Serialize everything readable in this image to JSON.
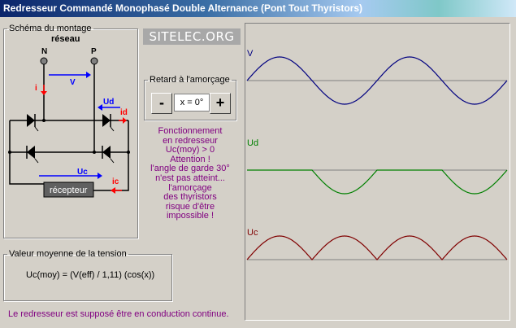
{
  "window": {
    "title": "Redresseur Commandé Monophasé Double Alternance (Pont Tout Thyristors)"
  },
  "schema": {
    "legend": "Schéma du montage",
    "network_label": "réseau",
    "node_n": "N",
    "node_p": "P",
    "label_i": "i",
    "label_v": "V",
    "label_ud": "Ud",
    "label_id": "id",
    "label_uc": "Uc",
    "label_ic": "ic",
    "receiver_label": "récepteur"
  },
  "brand": {
    "text": "SITELEC.ORG"
  },
  "firing": {
    "legend": "Retard à l'amorçage",
    "minus": "-",
    "plus": "+",
    "value": "x = 0°"
  },
  "status_message": [
    "Fonctionnement",
    "en redresseur",
    "Uc(moy) > 0",
    "Attention !",
    "l'angle de garde 30°",
    "n'est pas atteint...",
    "l'amorçage",
    "des thyristors",
    "risque d'être",
    "impossible !"
  ],
  "average": {
    "legend": "Valeur moyenne de la tension",
    "formula": "Uc(moy) = (V(eff) / 1,11) (cos(x))"
  },
  "footer_note": "Le redresseur est supposé être en conduction continue.",
  "scope": {
    "traces": [
      {
        "label": "V",
        "color": "#000080",
        "kind": "sine"
      },
      {
        "label": "Ud",
        "color": "#008000",
        "kind": "neg-rectified"
      },
      {
        "label": "Uc",
        "color": "#800000",
        "kind": "rectified"
      }
    ],
    "cycles": 2
  },
  "colors": {
    "accent_red": "#ff0000",
    "accent_blue": "#0000ff",
    "message": "#800080"
  }
}
